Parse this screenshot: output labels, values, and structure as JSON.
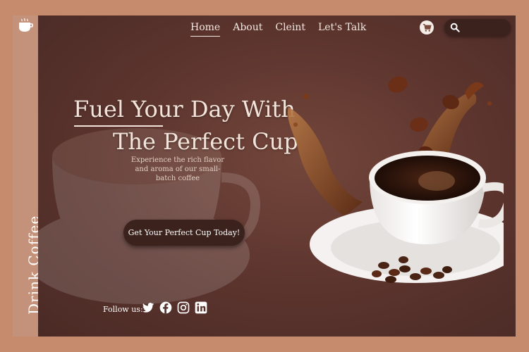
{
  "brand": {
    "logo_icon": "coffee-cup-icon",
    "side_text": "Drink Coffee"
  },
  "nav": {
    "items": [
      {
        "label": "Home",
        "active": true
      },
      {
        "label": "About",
        "active": false
      },
      {
        "label": "Cleint",
        "active": false
      },
      {
        "label": "Let's Talk",
        "active": false
      }
    ]
  },
  "header": {
    "cart_icon": "cart-icon",
    "search_icon": "search-icon",
    "search_value": ""
  },
  "hero": {
    "title_line1": "Fuel Your Day With",
    "title_line2": "The Perfect Cup",
    "subtitle": "Experience the rich flavor and aroma of our small-batch coffee",
    "cta_label": "Get Your Perfect Cup Today!"
  },
  "social": {
    "label": "Follow us:",
    "icons": [
      "twitter-icon",
      "facebook-icon",
      "instagram-icon",
      "linkedin-icon"
    ]
  },
  "colors": {
    "background": "#c68b6c",
    "panel": "#5a332d",
    "button": "#3b221d",
    "text": "#f2e4da"
  }
}
